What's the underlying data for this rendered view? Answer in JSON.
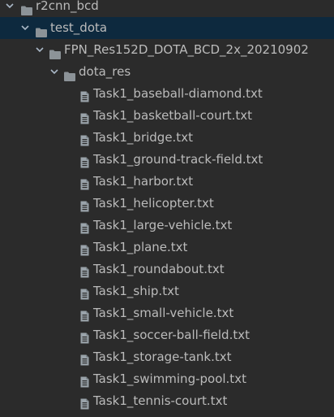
{
  "icons": {
    "folder": "folder-icon",
    "file": "text-file-icon",
    "expand": "chevron-down-icon"
  },
  "colors": {
    "background": "#2b2b2b",
    "selected_row": "#0d293e",
    "text": "#bbbbbb",
    "folder": "#8c9398"
  },
  "tree": {
    "folders": [
      {
        "name": "r2cnn_bcd",
        "expanded": true
      },
      {
        "name": "test_dota",
        "expanded": true,
        "selected": true
      },
      {
        "name": "FPN_Res152D_DOTA_BCD_2x_20210902",
        "expanded": true
      },
      {
        "name": "dota_res",
        "expanded": true
      }
    ],
    "files": [
      "Task1_baseball-diamond.txt",
      "Task1_basketball-court.txt",
      "Task1_bridge.txt",
      "Task1_ground-track-field.txt",
      "Task1_harbor.txt",
      "Task1_helicopter.txt",
      "Task1_large-vehicle.txt",
      "Task1_plane.txt",
      "Task1_roundabout.txt",
      "Task1_ship.txt",
      "Task1_small-vehicle.txt",
      "Task1_soccer-ball-field.txt",
      "Task1_storage-tank.txt",
      "Task1_swimming-pool.txt",
      "Task1_tennis-court.txt"
    ]
  }
}
